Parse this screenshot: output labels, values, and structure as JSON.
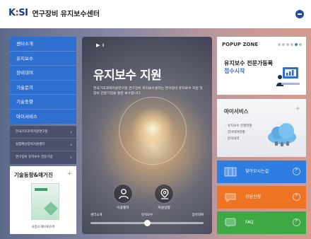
{
  "header": {
    "logo_text": "KISI",
    "site_name": "연구장비 유지보수센터",
    "menu_icon": "menu-icon"
  },
  "nav": {
    "items": [
      {
        "label": "센터소개"
      },
      {
        "label": "유지보수"
      },
      {
        "label": "장비대여"
      },
      {
        "label": "기술문의"
      },
      {
        "label": "기술동향"
      },
      {
        "label": "마이서비스"
      }
    ]
  },
  "links": {
    "items": [
      {
        "label": "한국기초과학지원연구원"
      },
      {
        "label": "실험확산장비지원센터"
      },
      {
        "label": "연구장비 유지보수 전문기업"
      }
    ]
  },
  "magazine": {
    "title": "기술동향&매거진",
    "caption": "사업소개브로슈어"
  },
  "hero": {
    "controls": "▶  ॥",
    "title": "유지보수 지원",
    "description": "한국기초과학지원연구원 연구장비 유지보수센터는 연구장비 유지보수 지원 및 장비 전문기업을 통한 보수합니다.",
    "buttons": [
      {
        "label": "이용절차",
        "icon": "user-icon"
      },
      {
        "label": "지원신청",
        "icon": "location-icon"
      }
    ],
    "slider": {
      "labels": [
        "센터소개",
        "유지보수",
        "장비대여"
      ],
      "selected_index": 1
    }
  },
  "popup": {
    "heading": "POPUP ZONE",
    "line1": "유지보수 전문가등록",
    "line2": "접수시작",
    "active_dot": 4,
    "dot_count": 6
  },
  "myservice": {
    "title": "마이서비스",
    "items": [
      "유지보수 진행현황",
      "장비대여현황",
      "문의내역"
    ]
  },
  "tiles": [
    {
      "label": "찾아오시는길",
      "color": "#2f7de0",
      "icon": "map-icon"
    },
    {
      "label": "상담신청",
      "color": "#ee7424",
      "icon": "chat-icon"
    },
    {
      "label": "FAQ",
      "color": "#3ea845",
      "icon": "faq-icon"
    }
  ],
  "colors": {
    "accent_blue": "#2f6fd0",
    "orange": "#ee7424",
    "green": "#3ea845",
    "logo_navy": "#1a3b7a",
    "logo_red": "#e0242c"
  }
}
